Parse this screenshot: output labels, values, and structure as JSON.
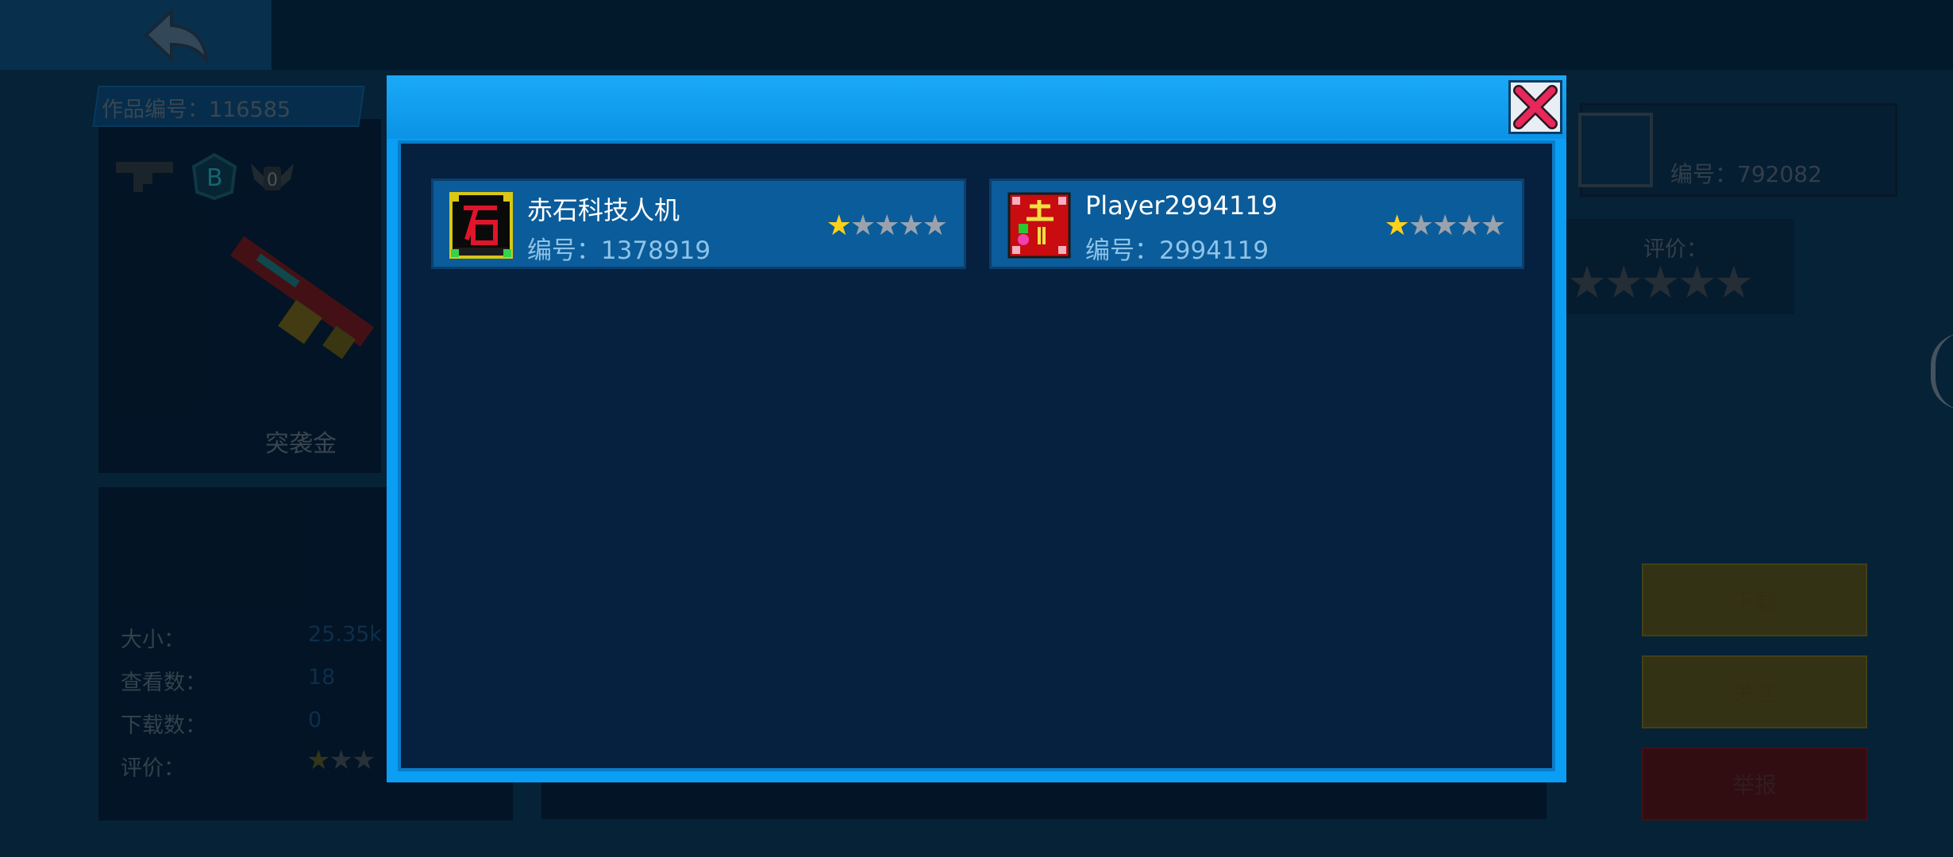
{
  "work_id_label": "作品编号：116585",
  "weapon_name": "突袭金",
  "stats": {
    "size_label": "大小：",
    "size_value": "25.35k",
    "views_label": "查看数：",
    "views_value": "18",
    "downloads_label": "下载数：",
    "downloads_value": "0",
    "rating_label": "评价："
  },
  "author": {
    "id_label": "编号：792082",
    "rating_label": "评价："
  },
  "buttons": {
    "download": "下载",
    "follow": "关注",
    "report": "举报"
  },
  "dialog": {
    "users": [
      {
        "name": "赤石科技人机",
        "id": "编号：1378919",
        "stars_filled": 1,
        "stars_total": 5
      },
      {
        "name": "Player2994119",
        "id": "编号：2994119",
        "stars_filled": 1,
        "stars_total": 5
      }
    ]
  },
  "icons": {
    "back": "back-arrow-icon",
    "close": "close-icon",
    "weapon": "smg-icon",
    "grade": "grade-b-badge-icon",
    "rank": "rank-0-wings-icon"
  },
  "colors": {
    "accent": "#0a9ef5",
    "close_x": "#e8285a",
    "star": "#ffd11a"
  }
}
